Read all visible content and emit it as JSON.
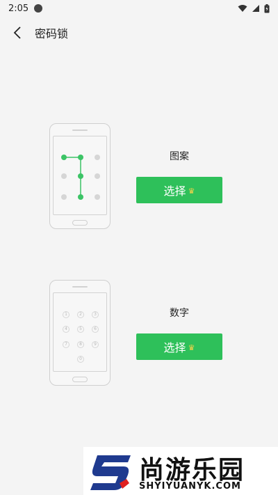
{
  "status_bar": {
    "time": "2:05"
  },
  "app_bar": {
    "title": "密码锁"
  },
  "options": [
    {
      "label": "图案",
      "button_label": "选择"
    },
    {
      "label": "数字",
      "button_label": "选择"
    }
  ],
  "keypad_digits": [
    "1",
    "2",
    "3",
    "4",
    "5",
    "6",
    "7",
    "8",
    "9",
    "0"
  ],
  "colors": {
    "accent": "#2ec05a",
    "crown": "#f7d34a",
    "background": "#f4f4f4"
  },
  "watermark": {
    "name": "尚游乐园",
    "domain": "SHYIYUANYK.COM"
  }
}
